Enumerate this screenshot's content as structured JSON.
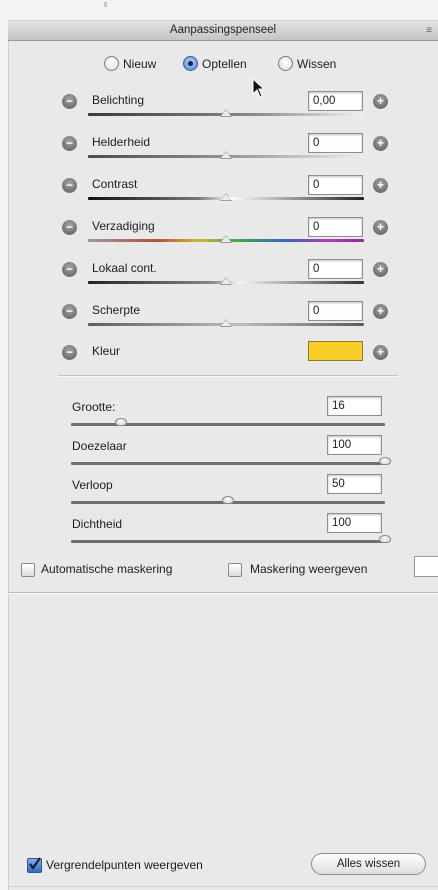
{
  "panel": {
    "title": "Aanpassingspenseel",
    "menu_icon": "panel-menu-icon"
  },
  "mode": {
    "options": [
      "Nieuw",
      "Optellen",
      "Wissen"
    ],
    "selected": "Optellen"
  },
  "adjustments": [
    {
      "label": "Belichting",
      "value": "0,00",
      "level": 0.5
    },
    {
      "label": "Helderheid",
      "value": "0",
      "level": 0.5
    },
    {
      "label": "Contrast",
      "value": "0",
      "level": 0.5
    },
    {
      "label": "Verzadiging",
      "value": "0",
      "level": 0.5
    },
    {
      "label": "Lokaal cont.",
      "value": "0",
      "level": 0.5
    },
    {
      "label": "Scherpte",
      "value": "0",
      "level": 0.5
    }
  ],
  "color": {
    "label": "Kleur",
    "swatch": "#f7cd28"
  },
  "brush": [
    {
      "label": "Grootte:",
      "value": "16",
      "level": 0.16
    },
    {
      "label": "Doezelaar",
      "value": "100",
      "level": 1.0
    },
    {
      "label": "Verloop",
      "value": "50",
      "level": 0.5
    },
    {
      "label": "Dichtheid",
      "value": "100",
      "level": 1.0
    }
  ],
  "options": {
    "auto_mask": {
      "label": "Automatische maskering",
      "checked": false
    },
    "show_mask": {
      "label": "Maskering weergeven",
      "checked": false
    }
  },
  "footer": {
    "show_pins": {
      "label": "Vergrendelpunten weergeven",
      "checked": true
    },
    "clear_all_label": "Alles wissen"
  }
}
